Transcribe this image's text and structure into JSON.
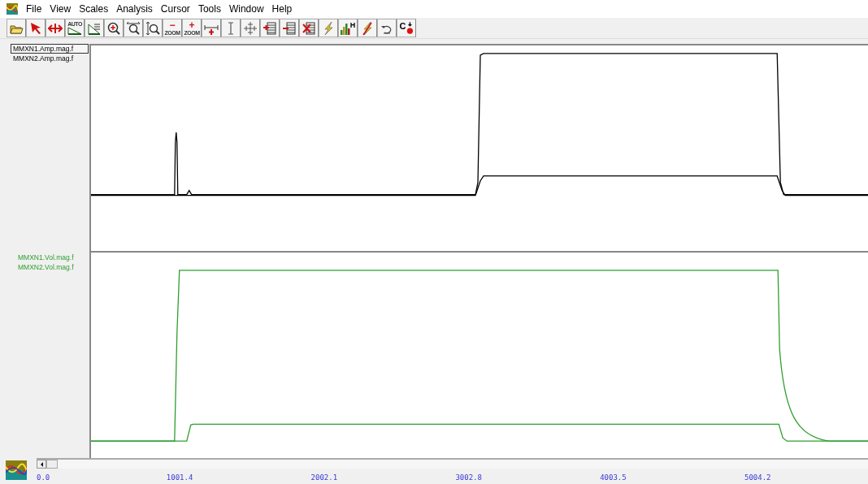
{
  "menu": [
    "File",
    "View",
    "Scales",
    "Analysis",
    "Cursor",
    "Tools",
    "Window",
    "Help"
  ],
  "toolbar": [
    {
      "kind": "open"
    },
    {
      "kind": "pointer"
    },
    {
      "kind": "hmove"
    },
    {
      "kind": "auto",
      "label": "AUTO"
    },
    {
      "kind": "scale"
    },
    {
      "kind": "zoomin"
    },
    {
      "kind": "zoomh"
    },
    {
      "kind": "zoomv"
    },
    {
      "kind": "zoomtext",
      "sign": "−",
      "label": "ZOOM"
    },
    {
      "kind": "zoomtext",
      "sign": "+",
      "label": "ZOOM"
    },
    {
      "kind": "hcursor"
    },
    {
      "kind": "ibeam"
    },
    {
      "kind": "cross"
    },
    {
      "kind": "listadd"
    },
    {
      "kind": "listremove"
    },
    {
      "kind": "listdelete"
    },
    {
      "kind": "bolt"
    },
    {
      "kind": "bars",
      "label": "H"
    },
    {
      "kind": "boltx"
    },
    {
      "kind": "undo"
    },
    {
      "kind": "cdot",
      "label": "C"
    }
  ],
  "panels": [
    {
      "color": "#000000",
      "traces": [
        {
          "label": "MMXN1.Amp.mag.f",
          "selected": true
        },
        {
          "label": "MMXN2.Amp.mag.f",
          "selected": false
        }
      ]
    },
    {
      "color": "#2e9e2e",
      "traces": [
        {
          "label": "MMXN1.Vol.mag.f",
          "selected": false
        },
        {
          "label": "MMXN2.Vol.mag.f",
          "selected": false
        }
      ]
    }
  ],
  "x_axis": [
    "0.0",
    "1001.4",
    "2002.1",
    "3002.8",
    "4003.5",
    "5004.2"
  ]
}
